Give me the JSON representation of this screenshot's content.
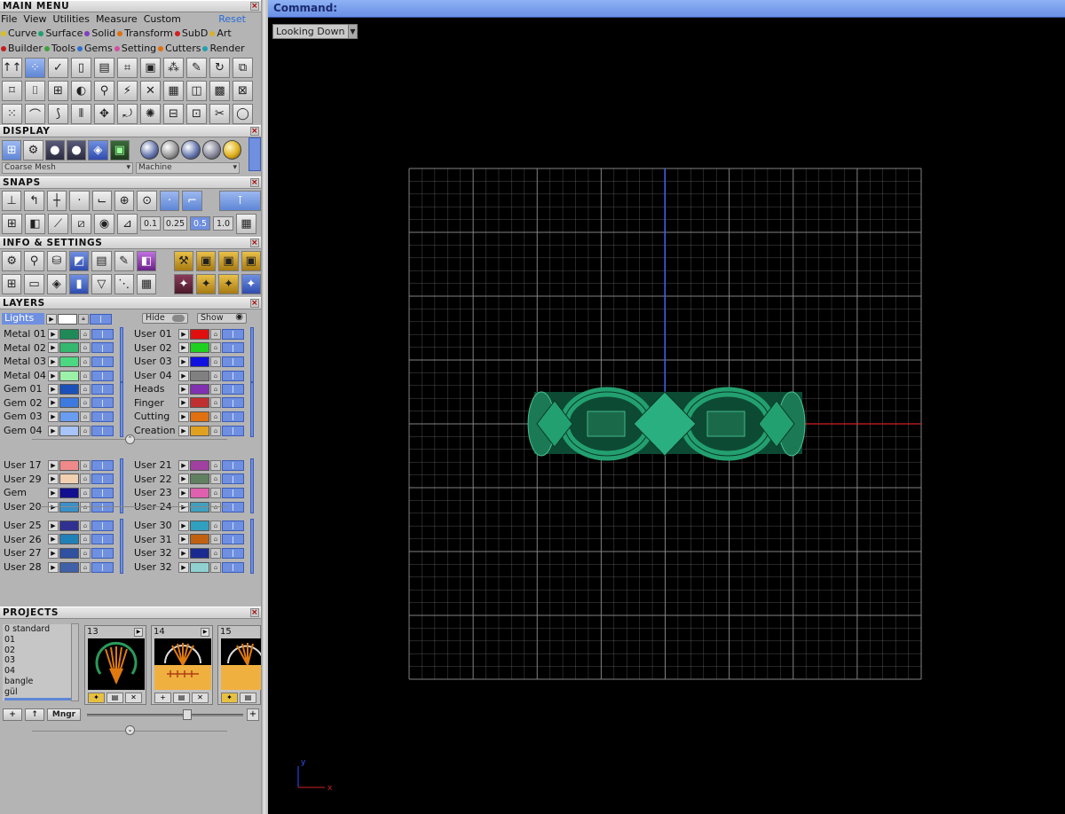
{
  "left_panel": {
    "main_menu": {
      "title": "MAIN MENU",
      "menu": [
        "File",
        "View",
        "Utilities",
        "Measure",
        "Custom"
      ],
      "reset": "Reset",
      "categories_row1": [
        {
          "label": "Curve",
          "color": "#d8c020"
        },
        {
          "label": "Surface",
          "color": "#20a070"
        },
        {
          "label": "Solid",
          "color": "#8040c0"
        },
        {
          "label": "Transform",
          "color": "#e07010"
        },
        {
          "label": "SubD",
          "color": "#d02020"
        },
        {
          "label": "Art",
          "color": "#d8b030"
        }
      ],
      "categories_row2": [
        {
          "label": "Builder",
          "color": "#c02020"
        },
        {
          "label": "Tools",
          "color": "#40a040"
        },
        {
          "label": "Gems",
          "color": "#3070d0"
        },
        {
          "label": "Setting",
          "color": "#d050a0"
        },
        {
          "label": "Cutters",
          "color": "#e07010"
        },
        {
          "label": "Render",
          "color": "#20a0b0"
        }
      ]
    },
    "display": {
      "title": "DISPLAY",
      "mesh_mode": "Coarse Mesh",
      "material": "Machine"
    },
    "snaps": {
      "title": "SNAPS",
      "values": [
        "0.1",
        "0.25",
        "0.5",
        "1.0"
      ],
      "selected_value": "0.5"
    },
    "info": {
      "title": "INFO & SETTINGS"
    },
    "layers": {
      "title": "LAYERS",
      "lights": "Lights",
      "hide": "Hide",
      "show": "Show",
      "left_groups": [
        [
          {
            "name": "Metal 01",
            "color": "#1e8a58"
          },
          {
            "name": "Metal 02",
            "color": "#34b870"
          },
          {
            "name": "Metal 03",
            "color": "#4cd880"
          },
          {
            "name": "Metal 04",
            "color": "#9cf0a8"
          }
        ],
        [
          {
            "name": "Gem 01",
            "color": "#1a50b8"
          },
          {
            "name": "Gem 02",
            "color": "#3d7ae0"
          },
          {
            "name": "Gem 03",
            "color": "#6a9cf0"
          },
          {
            "name": "Gem 04",
            "color": "#a8c4f8"
          }
        ],
        [
          {
            "name": "User 17",
            "color": "#f08a8a"
          },
          {
            "name": "User 29",
            "color": "#f0d0b0"
          },
          {
            "name": "Gem",
            "color": "#101090"
          },
          {
            "name": "User 20",
            "color": "#3a90c8"
          }
        ],
        [
          {
            "name": "User 25",
            "color": "#303090"
          },
          {
            "name": "User 26",
            "color": "#2080b8"
          },
          {
            "name": "User 27",
            "color": "#3050a0"
          },
          {
            "name": "User 28",
            "color": "#4060a8"
          }
        ]
      ],
      "right_groups": [
        [
          {
            "name": "User 01",
            "color": "#e01010"
          },
          {
            "name": "User 02",
            "color": "#20d020"
          },
          {
            "name": "User 03",
            "color": "#1010e0"
          },
          {
            "name": "User 04",
            "color": "#808080"
          }
        ],
        [
          {
            "name": "Heads",
            "color": "#8030b0"
          },
          {
            "name": "Finger",
            "color": "#c03030"
          },
          {
            "name": "Cutting",
            "color": "#e07010"
          },
          {
            "name": "Creation",
            "color": "#e0a020"
          }
        ],
        [
          {
            "name": "User 21",
            "color": "#a040a0"
          },
          {
            "name": "User 22",
            "color": "#608060"
          },
          {
            "name": "User 23",
            "color": "#e060b0"
          },
          {
            "name": "User 24",
            "color": "#40a0c0"
          }
        ],
        [
          {
            "name": "User 30",
            "color": "#30a0c0"
          },
          {
            "name": "User 31",
            "color": "#c06010"
          },
          {
            "name": "User 32",
            "color": "#1a2a90"
          },
          {
            "name": "User 32",
            "color": "#90d0d0"
          }
        ]
      ]
    },
    "projects": {
      "title": "PROJECTS",
      "list": [
        "0 standard",
        "01",
        "02",
        "03",
        "04",
        "bangle",
        "gül"
      ],
      "thumbnails": [
        "13",
        "14",
        "15"
      ],
      "buttons": {
        "add": "+",
        "up": "↑",
        "manager": "Mngr"
      }
    }
  },
  "command": {
    "label": "Command:"
  },
  "viewport": {
    "view_name": "Looking Down",
    "axis_x": "x",
    "axis_y": "y",
    "colors": {
      "grid": "#8a8a8a",
      "object": "#1f8a62",
      "axis_y": "#3050ff",
      "axis_x": "#d02020"
    }
  }
}
